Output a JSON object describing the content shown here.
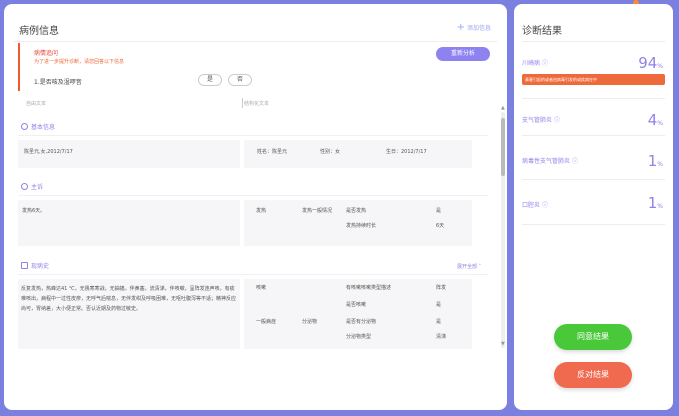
{
  "case_info": {
    "title": "病例信息",
    "add_info": "添加信息",
    "query": {
      "title": "病情追问",
      "hint": "为了进一步提升诊断，请您回答以下信息",
      "question": "1.是否咳及湿啰音",
      "yes": "是",
      "no": "否",
      "reanalyze": "重新分析"
    },
    "free_text_label": "自由文本",
    "structured_label": "结构化文本",
    "basic": {
      "heading": "基本信息",
      "summary": "陈圣元,女,2012/7/17",
      "name": "姓名：陈圣元",
      "gender": "性别：女",
      "birthday": "生日：2012/7/17"
    },
    "complaint": {
      "heading": "主诉",
      "text": "发热6天。",
      "c1": "发热",
      "c2": "发热一般情况",
      "c3": "是否发热",
      "c4": "是",
      "c5": "发热持续时长",
      "c6": "6天"
    },
    "history": {
      "heading": "现病史",
      "expand": "展开全部",
      "text": "反复发热，热峰达41 ℃，无畏寒寒战，无抽搐。伴鼻塞，流清涕，伴咳嗽，呈阵发连声咳，有痰难咳出，病程中一过性皮疹，无呼气后喘息，无伴发绀及呼吸困难，无呕吐腹泻等不适；精神反应尚可，胃纳差，大小便正常。否认近期及药物过敏史。",
      "r1a": "咳嗽",
      "r1b": "有咳嗽咳嗽类型描述",
      "r1c": "阵发",
      "r2b": "是否咳嗽",
      "r2c": "是",
      "r3a": "一般病症",
      "r3b": "分泌物",
      "r3c": "是否有分泌物",
      "r3d": "是",
      "r4c": "分泌物类型",
      "r4d": "清涕"
    }
  },
  "diagnosis": {
    "title": "诊断结果",
    "items": [
      {
        "name": "川崎病",
        "value": "94",
        "unit": "%",
        "note": "鼻塞引起的或者由病毒引发的或疾病在中"
      },
      {
        "name": "支气管肺炎",
        "value": "4",
        "unit": "%"
      },
      {
        "name": "病毒性支气管肺炎",
        "value": "1",
        "unit": "%"
      },
      {
        "name": "口腔炎",
        "value": "1",
        "unit": "%"
      }
    ],
    "agree": "同意结果",
    "oppose": "反对结果"
  },
  "colors": {
    "background": "#7b7fe0",
    "accent": "#8f84e8",
    "agree": "#49c83a",
    "oppose": "#ef6a4e",
    "warning": "#f05a28"
  }
}
